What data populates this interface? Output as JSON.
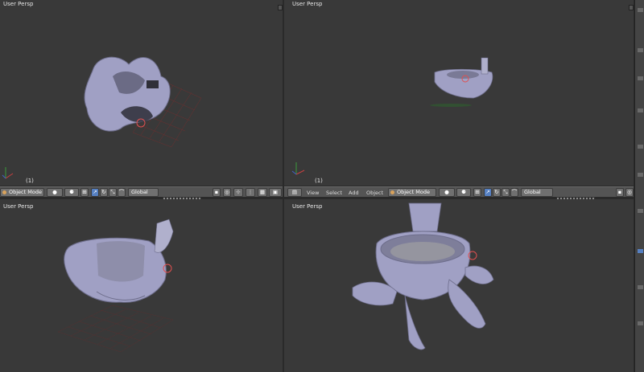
{
  "viewports": [
    {
      "title": "User Persp",
      "frame": "(1)"
    },
    {
      "title": "User Persp",
      "frame": "(1)"
    },
    {
      "title": "User Persp",
      "frame": ""
    },
    {
      "title": "User Persp",
      "frame": ""
    }
  ],
  "header_left": {
    "mode": "Object Mode",
    "orientation": "Global"
  },
  "header_right": {
    "menu": [
      "View",
      "Select",
      "Add",
      "Object"
    ],
    "mode": "Object Mode",
    "orientation": "Global"
  },
  "colors": {
    "viewport_bg": "#393939",
    "header_bg": "#545454",
    "mesh": "#a0a0c4",
    "accent_blue": "#5680c2"
  }
}
